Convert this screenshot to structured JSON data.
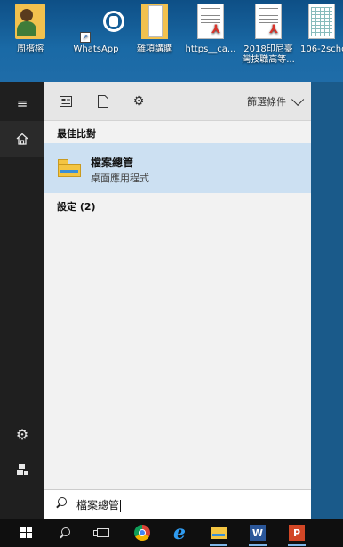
{
  "desktop": {
    "icons": [
      {
        "label": "周楷榕",
        "icon": "user-folder-icon"
      },
      {
        "label": "WhatsApp",
        "icon": "whatsapp-icon"
      },
      {
        "label": "雜項講購",
        "icon": "folder-icon"
      },
      {
        "label": "https__ca...",
        "icon": "pdf-icon"
      },
      {
        "label": "2018印尼臺灣技職高等...",
        "icon": "pdf-icon"
      },
      {
        "label": "106-2scho",
        "icon": "spreadsheet-icon"
      }
    ]
  },
  "start_menu": {
    "rail": {
      "items": [
        "hamburger-menu-icon",
        "home-icon",
        "settings-icon",
        "user-icon"
      ]
    },
    "header": {
      "filter_label": "篩選條件"
    },
    "best_match": {
      "title": "最佳比對",
      "item_name": "檔案總管",
      "item_type": "桌面應用程式"
    },
    "settings_section": {
      "title": "設定 (2)"
    },
    "search": {
      "query": "檔案總管"
    }
  },
  "taskbar": {
    "items": [
      "windows-start-icon",
      "search-icon",
      "task-view-icon",
      "chrome-icon",
      "edge-icon",
      "file-explorer-icon",
      "word-icon",
      "powerpoint-icon"
    ],
    "word_label": "W",
    "ppt_label": "P"
  },
  "colors": {
    "highlight": "#cce0f2",
    "panel": "#f2f2f2",
    "rail": "#1f1f1f",
    "taskbar": "#0f0f0f"
  }
}
